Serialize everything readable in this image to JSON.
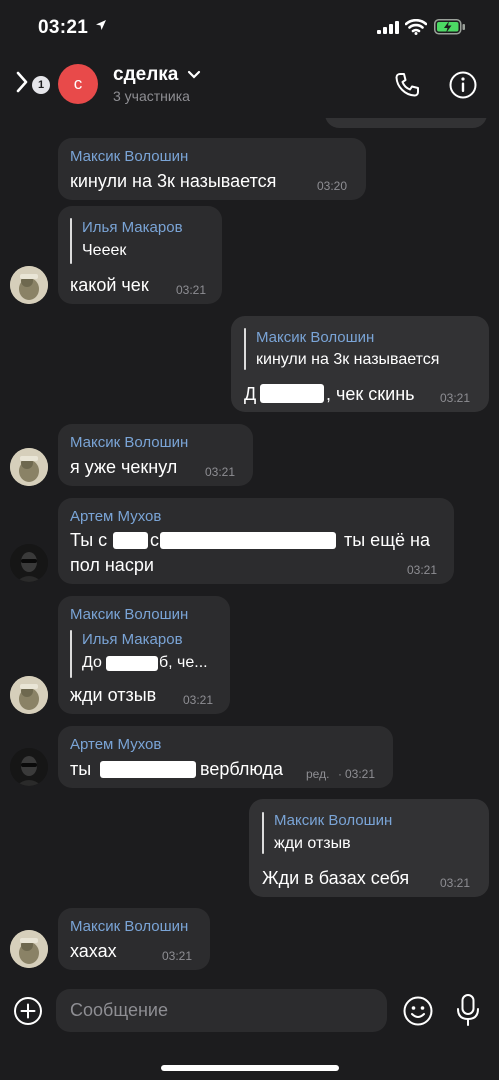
{
  "status": {
    "time": "03:21",
    "battery_color": "#4cd964"
  },
  "header": {
    "back_badge": "1",
    "avatar_letter": "с",
    "title": "сделка",
    "subtitle": "3 участника",
    "icons": {
      "back": "back-chevron-icon",
      "call": "phone-icon",
      "info": "info-icon",
      "dropdown": "chevron-down-icon"
    }
  },
  "messages": [
    {
      "sender": "Максик Волошин",
      "text": "кинули на 3к называется",
      "time": "03:20"
    },
    {
      "sender": "Илья Макаров",
      "quote_text": "Чееек",
      "text": "какой чек",
      "time": "03:21"
    },
    {
      "quote_sender": "Максик Волошин",
      "quote_text": "кинули на 3к называется",
      "text_start": "Д",
      "text_end": ", чек скинь",
      "time": "03:21",
      "outgoing": true
    },
    {
      "sender": "Максик Волошин",
      "text": "я уже чекнул",
      "time": "03:21"
    },
    {
      "sender": "Артем Мухов",
      "line1_a": "Ты с",
      "line1_b": "с",
      "line1_c": "ты ещё на",
      "line2": "пол насри",
      "time": "03:21"
    },
    {
      "sender": "Максик Волошин",
      "quote_sender": "Илья Макаров",
      "quote_start": "До",
      "quote_end": "б, че...",
      "text": "жди отзыв",
      "time": "03:21"
    },
    {
      "sender": "Артем Мухов",
      "text_start": "ты",
      "text_end": "верблюда",
      "edited": "ред.",
      "time": "03:21"
    },
    {
      "quote_sender": "Максик Волошин",
      "quote_text": "жди отзыв",
      "text": "Жди в базах себя",
      "time": "03:21",
      "outgoing": true
    },
    {
      "sender": "Максик Волошин",
      "text": "хахах",
      "time": "03:21"
    }
  ],
  "composer": {
    "placeholder": "Сообщение",
    "icons": {
      "attach": "plus-circle-icon",
      "emoji": "emoji-icon",
      "mic": "microphone-icon"
    }
  }
}
